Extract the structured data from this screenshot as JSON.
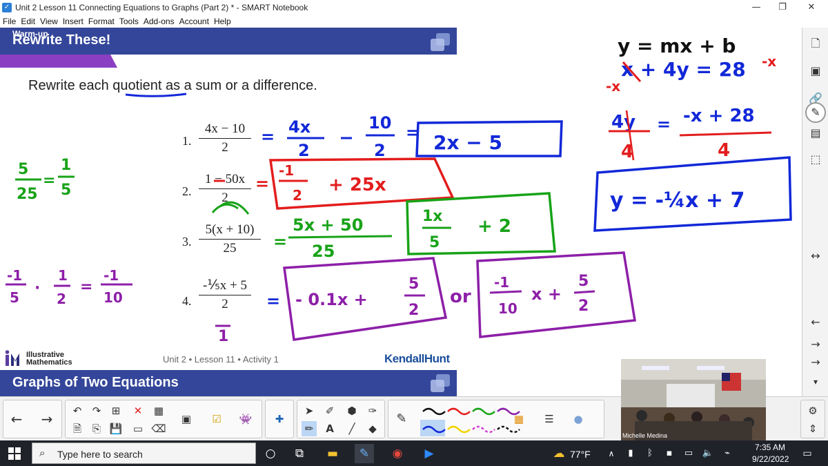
{
  "window": {
    "title": "Unit 2 Lesson 11 Connecting Equations to Graphs (Part 2) * - SMART Notebook",
    "min_icon": "minimize-icon",
    "max_icon": "restore-icon",
    "close_icon": "close-icon"
  },
  "menu": [
    "File",
    "Edit",
    "View",
    "Insert",
    "Format",
    "Tools",
    "Add-ons",
    "Account",
    "Help"
  ],
  "slide": {
    "banner_title": "Rewrite These!",
    "sub_banner": "Warm-up",
    "instruction": "Rewrite each quotient as a sum or a difference.",
    "problems": [
      {
        "num": "1.",
        "numerator": "4x − 10",
        "denominator": "2"
      },
      {
        "num": "2.",
        "numerator": "1 − 50x",
        "denominator": "2"
      },
      {
        "num": "3.",
        "numerator": "5(x + 10)",
        "denominator": "25"
      },
      {
        "num": "4.",
        "numerator": "-⅕x + 5",
        "denominator": "2"
      }
    ],
    "footer_logo": "Illustrative Mathematics",
    "footer_logo_line1": "Illustrative",
    "footer_logo_line2": "Mathematics",
    "footer_center": "Unit 2 • Lesson 11 • Activity 1",
    "footer_right": "KendallHunt",
    "next_banner_title": "Graphs of Two Equations"
  },
  "ink": {
    "colors": {
      "blue": "#1228d8",
      "red": "#e31d1d",
      "green": "#18a318",
      "purple": "#8d1fa8"
    },
    "top_right_1": "y = mx + b",
    "top_right_2": "x + 4y = 28",
    "top_right_minus_x": "-x",
    "top_right_minus_x2": "-x",
    "step_left_frac_num": "4y",
    "step_left_frac_den": "4",
    "step_right_num": "-x + 28",
    "step_right_den": "4",
    "boxed_answer": "y = -¼x + 7",
    "p1_frac_a_num": "4x",
    "p1_frac_a_den": "2",
    "p1_frac_b_num": "10",
    "p1_frac_b_den": "2",
    "p1_answer": "2x − 5",
    "p2_answer_frac_num": "-1",
    "p2_answer_frac_den": "2",
    "p2_answer_rest": "+ 25x",
    "p3_frac_num": "5x + 50",
    "p3_frac_den": "25",
    "p3_answer_frac_num": "1x",
    "p3_answer_frac_den": "5",
    "p3_answer_rest": "+ 2",
    "p4_denominator_extra": "1",
    "p4_answer_a": "- 0.1x +",
    "p4_answer_a_frac_num": "5",
    "p4_answer_a_frac_den": "2",
    "p4_or": "or",
    "p4_answer_b_frac_num": "-1",
    "p4_answer_b_frac_den": "10",
    "p4_answer_b_rest": "x +",
    "p4_answer_b_frac2_num": "5",
    "p4_answer_b_frac2_den": "2",
    "left_note_1_num_a": "5",
    "left_note_1_den_a": "25",
    "left_note_1_num_b": "1",
    "left_note_1_den_b": "5",
    "left_note_2_a_num": "-1",
    "left_note_2_a_den": "5",
    "left_note_2_dot": "·",
    "left_note_2_b_num": "1",
    "left_note_2_b_den": "2",
    "left_note_2_c_num": "-1",
    "left_note_2_c_den": "10",
    "equals": "="
  },
  "webcam": {
    "name": "Michelle Medina"
  },
  "taskbar": {
    "search_placeholder": "Type here to search",
    "weather": "77°F",
    "time": "7:35 AM",
    "date": "9/22/2022"
  }
}
